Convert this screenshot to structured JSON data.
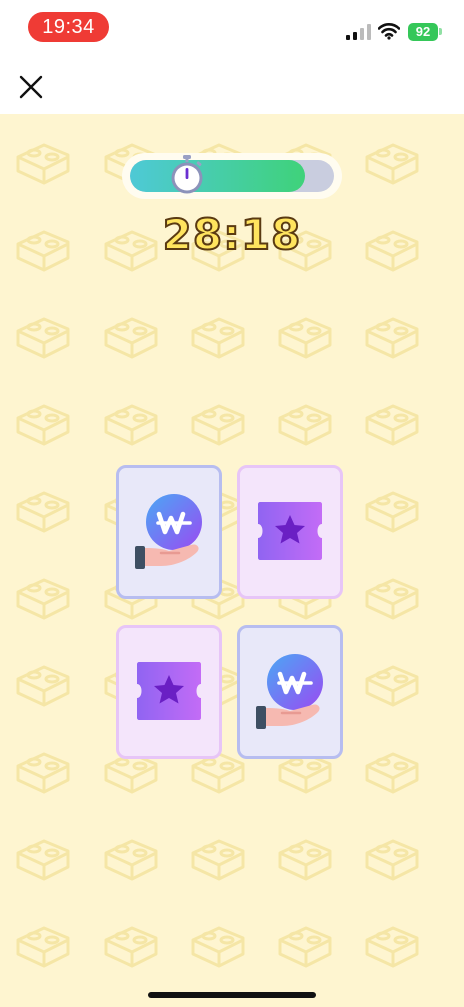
{
  "status_bar": {
    "time": "19:34",
    "battery": "92"
  },
  "header": {
    "close_icon": "close-icon"
  },
  "timer": {
    "progress": 0.86,
    "countdown": "28:18",
    "icon": "stopwatch-icon"
  },
  "colors": {
    "background": "#fef5d0",
    "timer_fill_start": "#4ec9d6",
    "timer_fill_end": "#3fd27a",
    "cash_card": "#e8e8f9",
    "ticket_card": "#f4e5fb",
    "status_time_pill": "#ef3b35"
  },
  "cards": [
    {
      "icon": "cash-hand-icon"
    },
    {
      "icon": "star-ticket-icon"
    },
    {
      "icon": "star-ticket-icon"
    },
    {
      "icon": "cash-hand-icon"
    }
  ]
}
